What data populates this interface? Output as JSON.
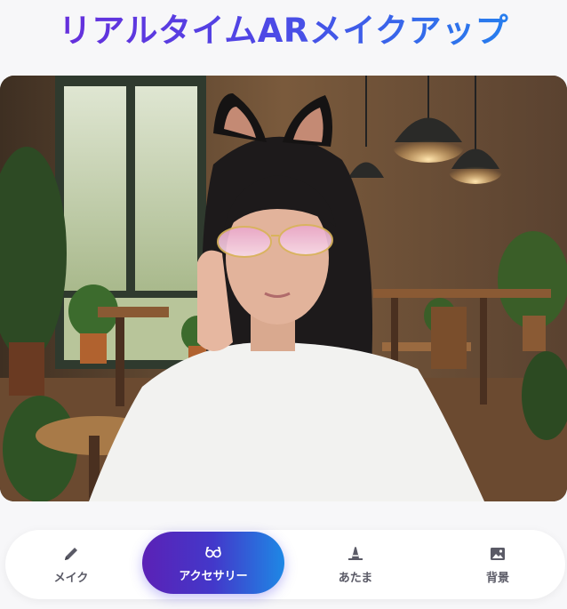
{
  "app": {
    "title": "リアルタイムARメイクアップ"
  },
  "camera": {
    "scene": "cafe-interior-with-cat-ears-and-pink-glasses-effect"
  },
  "nav": {
    "items": [
      {
        "label": "メイク",
        "icon": "pencil-icon",
        "active": false
      },
      {
        "label": "アクセサリー",
        "icon": "glasses-icon",
        "active": true
      },
      {
        "label": "あたま",
        "icon": "witch-hat-icon",
        "active": false
      },
      {
        "label": "背景",
        "icon": "image-icon",
        "active": false
      }
    ]
  },
  "colors": {
    "accent_start": "#5b21b6",
    "accent_end": "#1e88e5",
    "icon_gray": "#5a5a66"
  }
}
